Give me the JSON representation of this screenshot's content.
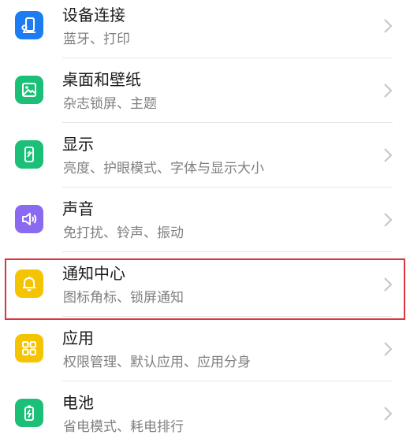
{
  "settings": {
    "items": [
      {
        "title": "设备连接",
        "subtitle": "蓝牙、打印",
        "icon": "device-connect-icon",
        "color": "#1e7cf2"
      },
      {
        "title": "桌面和壁纸",
        "subtitle": "杂志锁屏、主题",
        "icon": "wallpaper-icon",
        "color": "#1bbf78"
      },
      {
        "title": "显示",
        "subtitle": "亮度、护眼模式、字体与显示大小",
        "icon": "display-icon",
        "color": "#1bbf78"
      },
      {
        "title": "声音",
        "subtitle": "免打扰、铃声、振动",
        "icon": "sound-icon",
        "color": "#8a6af0"
      },
      {
        "title": "通知中心",
        "subtitle": "图标角标、锁屏通知",
        "icon": "bell-icon",
        "color": "#f5c400"
      },
      {
        "title": "应用",
        "subtitle": "权限管理、默认应用、应用分身",
        "icon": "apps-grid-icon",
        "color": "#f5c400"
      },
      {
        "title": "电池",
        "subtitle": "省电模式、耗电排行",
        "icon": "battery-icon",
        "color": "#1bbf78"
      }
    ]
  }
}
